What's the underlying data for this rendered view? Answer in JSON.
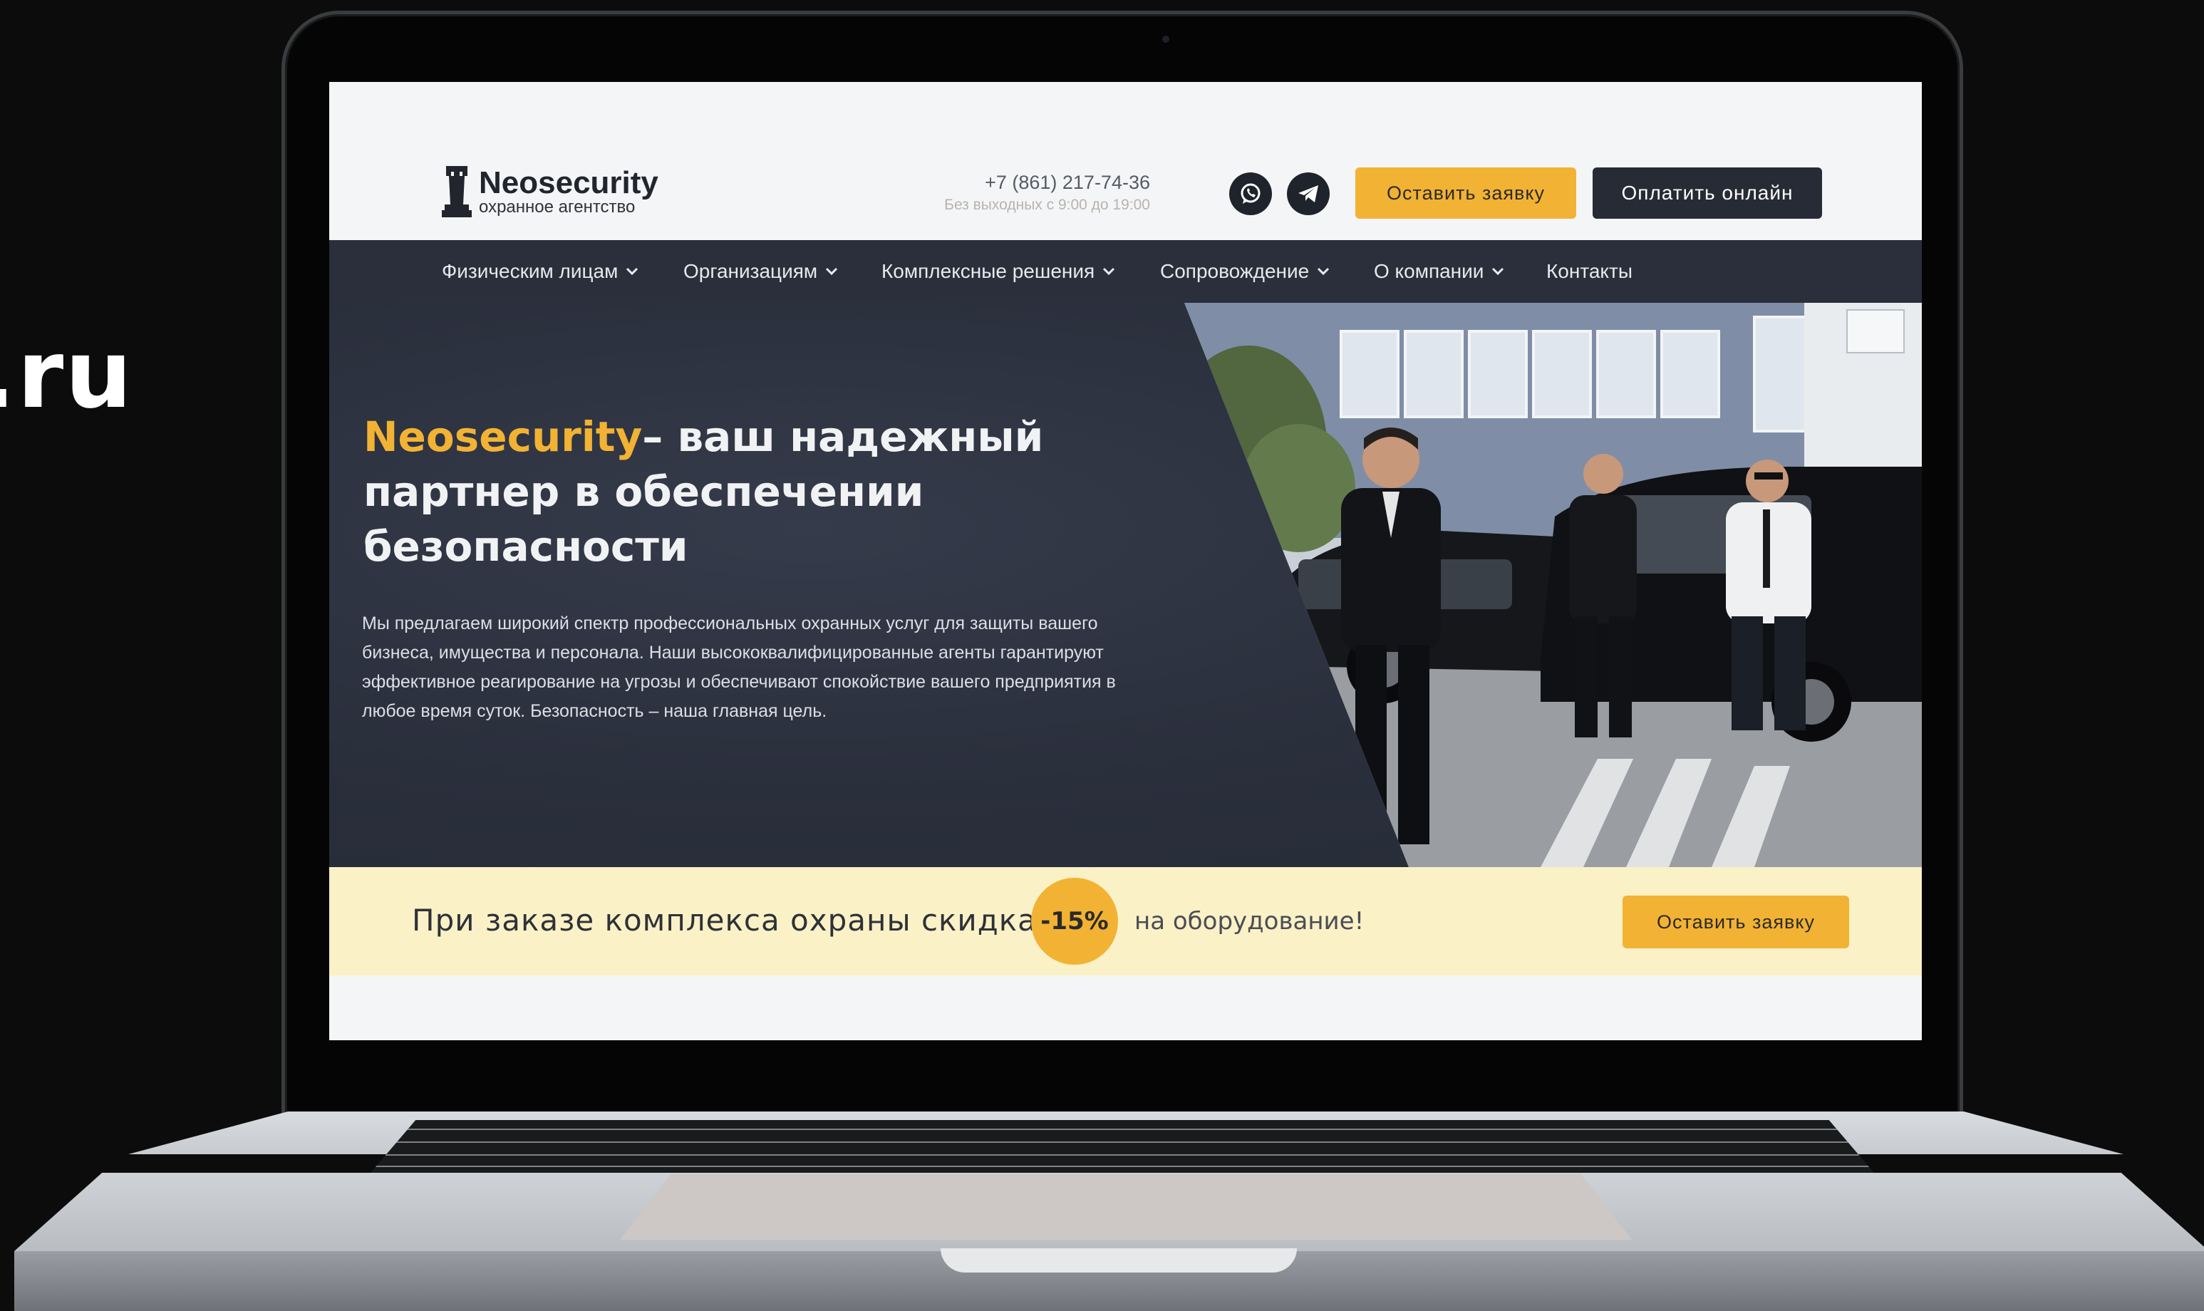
{
  "background_text": ".ru",
  "header": {
    "logo_name": "Neosecurity",
    "logo_tagline": "охранное агентство",
    "phone": "+7 (861) 217-74-36",
    "hours": "Без выходных с 9:00 до 19:00",
    "request_button": "Оставить заявку",
    "pay_button": "Оплатить онлайн",
    "social": [
      "whatsapp-icon",
      "telegram-icon"
    ]
  },
  "nav": {
    "items": [
      {
        "label": "Физическим лицам",
        "has_dropdown": true
      },
      {
        "label": "Организациям",
        "has_dropdown": true
      },
      {
        "label": "Комплексные решения",
        "has_dropdown": true
      },
      {
        "label": "Сопровождение",
        "has_dropdown": true
      },
      {
        "label": "О компании",
        "has_dropdown": true
      },
      {
        "label": "Контакты",
        "has_dropdown": false
      }
    ]
  },
  "hero": {
    "brand": "Neosecurity",
    "headline_rest": "– ваш надежный партнер в обеспечении безопасности",
    "lead": "Мы предлагаем широкий спектр профессиональных охранных услуг для защиты вашего бизнеса, имущества и персонала. Наши высококвалифицированные агенты гарантируют эффективное реагирование на угрозы и обеспечивают спокойствие вашего предприятия в любое время суток. Безопасность – наша главная цель."
  },
  "promo": {
    "text": "При заказе комплекса охраны скидка",
    "discount": "-15%",
    "text_after": "на оборудование!",
    "button": "Оставить заявку"
  },
  "colors": {
    "accent": "#f2b233",
    "dark": "#262b35",
    "hero_bg": "#2b3140",
    "promo_bg": "#faf1c6"
  }
}
